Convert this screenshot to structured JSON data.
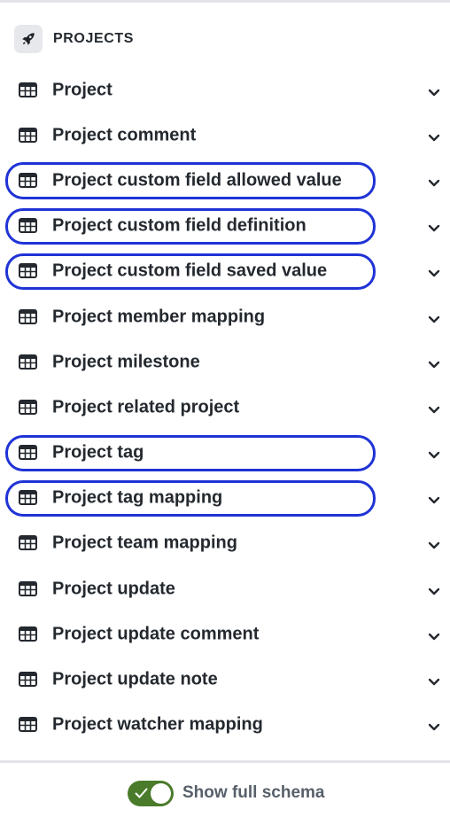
{
  "section": {
    "title": "PROJECTS",
    "icon": "rocket-icon"
  },
  "items": [
    {
      "label": "Project",
      "highlighted": false
    },
    {
      "label": "Project comment",
      "highlighted": false
    },
    {
      "label": "Project custom field allowed value",
      "highlighted": true
    },
    {
      "label": "Project custom field definition",
      "highlighted": true
    },
    {
      "label": "Project custom field saved value",
      "highlighted": true
    },
    {
      "label": "Project member mapping",
      "highlighted": false
    },
    {
      "label": "Project milestone",
      "highlighted": false
    },
    {
      "label": "Project related project",
      "highlighted": false
    },
    {
      "label": "Project tag",
      "highlighted": true
    },
    {
      "label": "Project tag mapping",
      "highlighted": true
    },
    {
      "label": "Project team mapping",
      "highlighted": false
    },
    {
      "label": "Project update",
      "highlighted": false
    },
    {
      "label": "Project update comment",
      "highlighted": false
    },
    {
      "label": "Project update note",
      "highlighted": false
    },
    {
      "label": "Project watcher mapping",
      "highlighted": false
    }
  ],
  "footer": {
    "toggle_label": "Show full schema",
    "toggle_on": true
  },
  "colors": {
    "highlight": "#1f33d6",
    "toggle": "#4a7b2a"
  }
}
